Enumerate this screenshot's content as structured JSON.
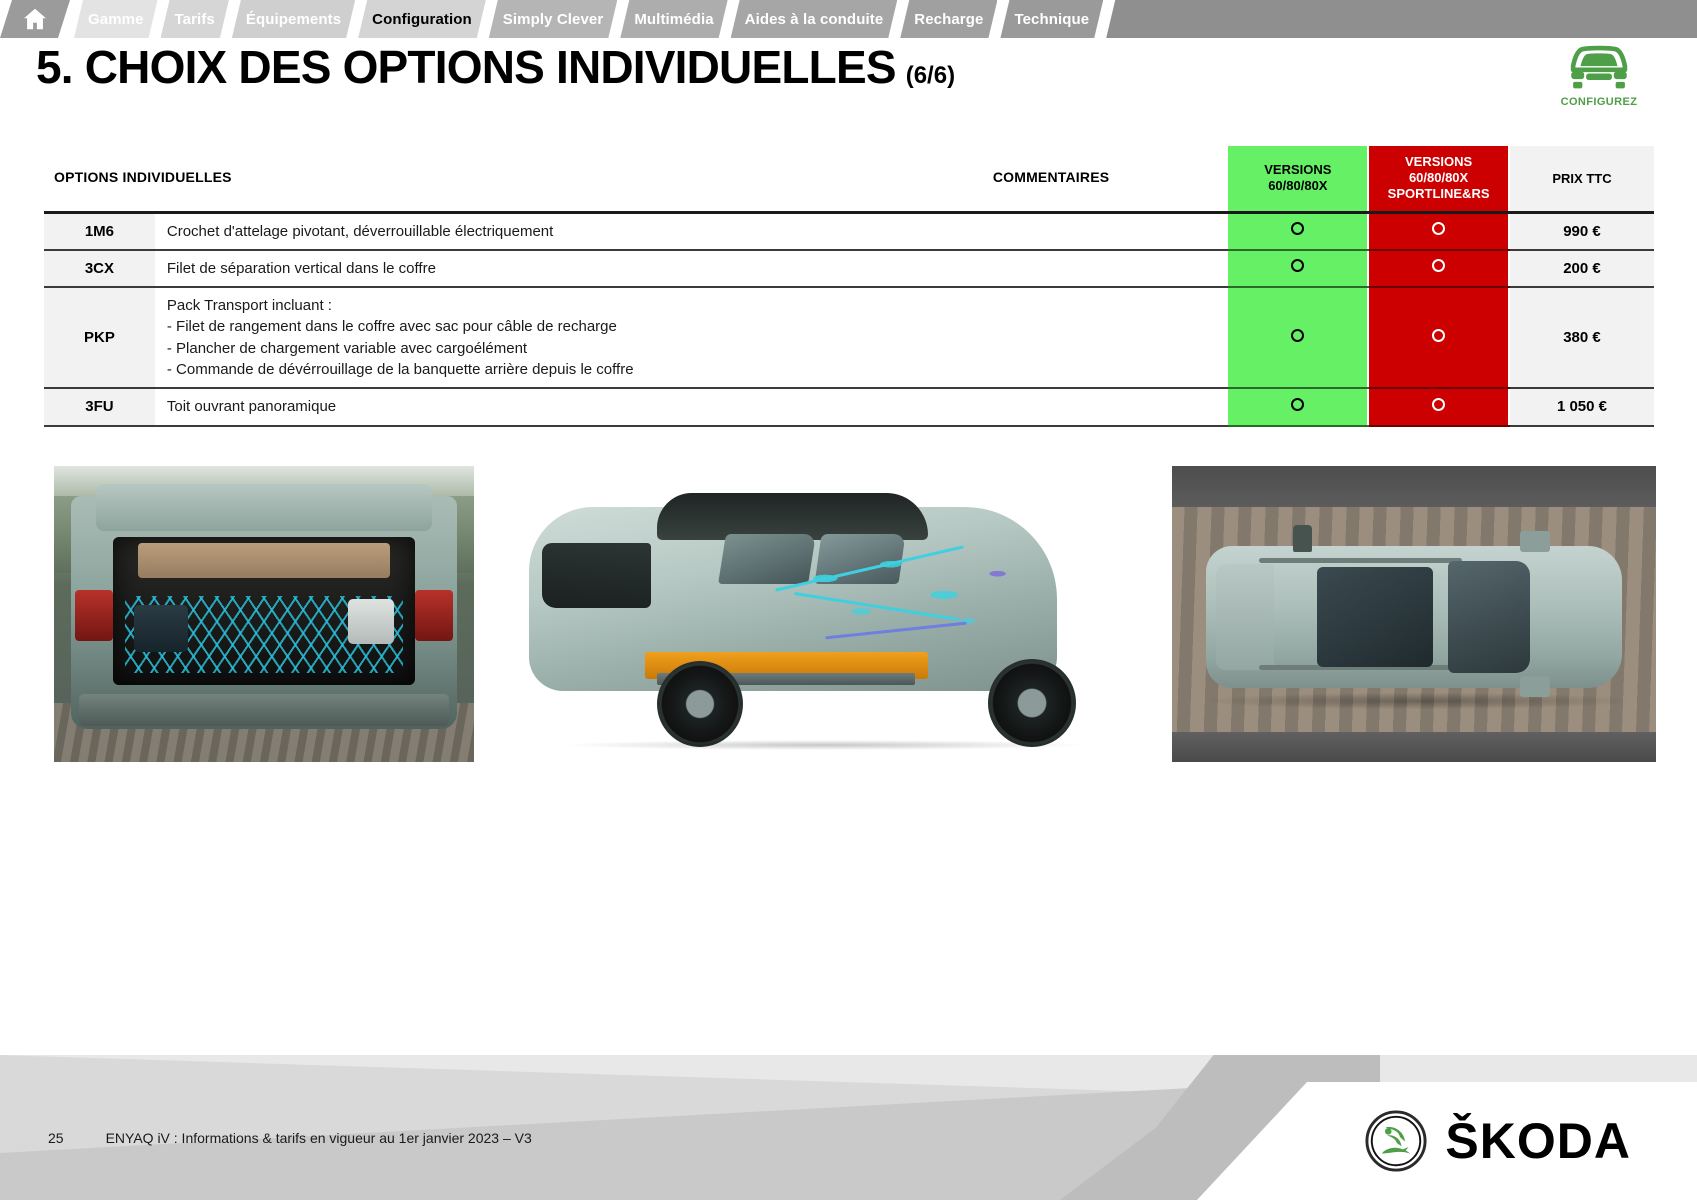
{
  "nav": {
    "home_icon": "home-icon",
    "tabs": [
      {
        "label": "Gamme",
        "active": false,
        "tone": "l1"
      },
      {
        "label": "Tarifs",
        "active": false,
        "tone": "l2"
      },
      {
        "label": "Équipements",
        "active": false,
        "tone": "l3"
      },
      {
        "label": "Configuration",
        "active": true,
        "tone": "active"
      },
      {
        "label": "Simply Clever",
        "active": false,
        "tone": "d1"
      },
      {
        "label": "Multimédia",
        "active": false,
        "tone": "d2"
      },
      {
        "label": "Aides à la conduite",
        "active": false,
        "tone": "d3"
      },
      {
        "label": "Recharge",
        "active": false,
        "tone": "d4"
      },
      {
        "label": "Technique",
        "active": false,
        "tone": "d5"
      }
    ]
  },
  "header": {
    "title": "5. CHOIX DES OPTIONS INDIVIDUELLES",
    "pagination": "(6/6)"
  },
  "configurez": {
    "label": "CONFIGUREZ",
    "icon": "car-front-icon",
    "color": "#4f9e48"
  },
  "table": {
    "columns": {
      "code": "OPTIONS INDIVIDUELLES",
      "comments": "COMMENTAIRES",
      "versions_standard": "VERSIONS\n60/80/80X",
      "versions_standard_line1": "VERSIONS",
      "versions_standard_line2": "60/80/80X",
      "versions_sport_line1": "VERSIONS",
      "versions_sport_line2": "60/80/80X",
      "versions_sport_line3": "SPORTLINE&RS",
      "price": "PRIX TTC"
    },
    "colors": {
      "green": "#66f066",
      "red": "#cc0000",
      "price_bg": "#f2f2f2"
    },
    "rows": [
      {
        "code": "1M6",
        "description": "Crochet d'attelage pivotant, déverrouillable électriquement",
        "comment": "",
        "standard": "○",
        "sportline": "○",
        "price": "990 €"
      },
      {
        "code": "3CX",
        "description": "Filet de séparation vertical dans le coffre",
        "comment": "",
        "standard": "○",
        "sportline": "○",
        "price": "200 €"
      },
      {
        "code": "PKP",
        "description": "Pack Transport incluant :\n- Filet de rangement dans le coffre avec sac pour câble de recharge\n- Plancher de chargement variable avec cargoélément\n- Commande de dévérrouillage de la banquette arrière depuis le coffre",
        "description_lines": [
          "Pack Transport incluant :",
          "- Filet de rangement dans le coffre avec sac pour câble de recharge",
          "- Plancher de chargement variable avec cargoélément",
          "- Commande de dévérrouillage de la banquette arrière depuis le coffre"
        ],
        "comment": "",
        "standard": "○",
        "sportline": "○",
        "price": "380 €"
      },
      {
        "code": "3FU",
        "description": "Toit ouvrant panoramique",
        "comment": "",
        "standard": "○",
        "sportline": "○",
        "price": "1 050 €"
      }
    ]
  },
  "photos": [
    {
      "caption": "Coffre ouvert avec filet de rangement"
    },
    {
      "caption": "Vue écorchée arrière trois-quarts ENYAQ iV"
    },
    {
      "caption": "Vue de dessus toit ouvrant panoramique"
    }
  ],
  "footer": {
    "page_number": "25",
    "note": "ENYAQ iV : Informations & tarifs en vigueur au 1er janvier 2023 – V3",
    "brand": "ŠKODA"
  }
}
